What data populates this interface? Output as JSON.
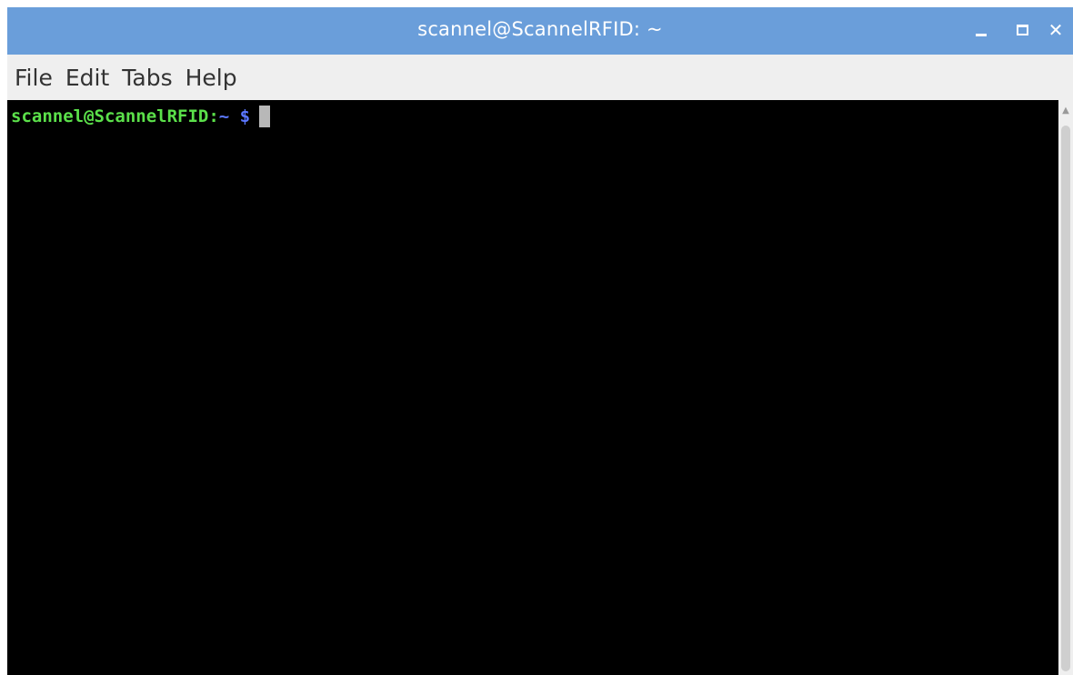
{
  "window": {
    "title": "scannel@ScannelRFID: ~",
    "controls": {
      "minimize_icon": "minimize-icon",
      "maximize_icon": "maximize-icon",
      "close_icon": "close-icon",
      "close_glyph": "✕"
    }
  },
  "menu": {
    "items": [
      {
        "label": "File"
      },
      {
        "label": "Edit"
      },
      {
        "label": "Tabs"
      },
      {
        "label": "Help"
      }
    ]
  },
  "terminal": {
    "prompt_user_host": "scannel@ScannelRFID",
    "prompt_separator": ":",
    "prompt_path": "~ $",
    "background_color": "#000000",
    "user_color": "#5be04a",
    "path_color": "#5b77ff"
  },
  "colors": {
    "titlebar": "#6a9eda",
    "menubar": "#efefef"
  }
}
